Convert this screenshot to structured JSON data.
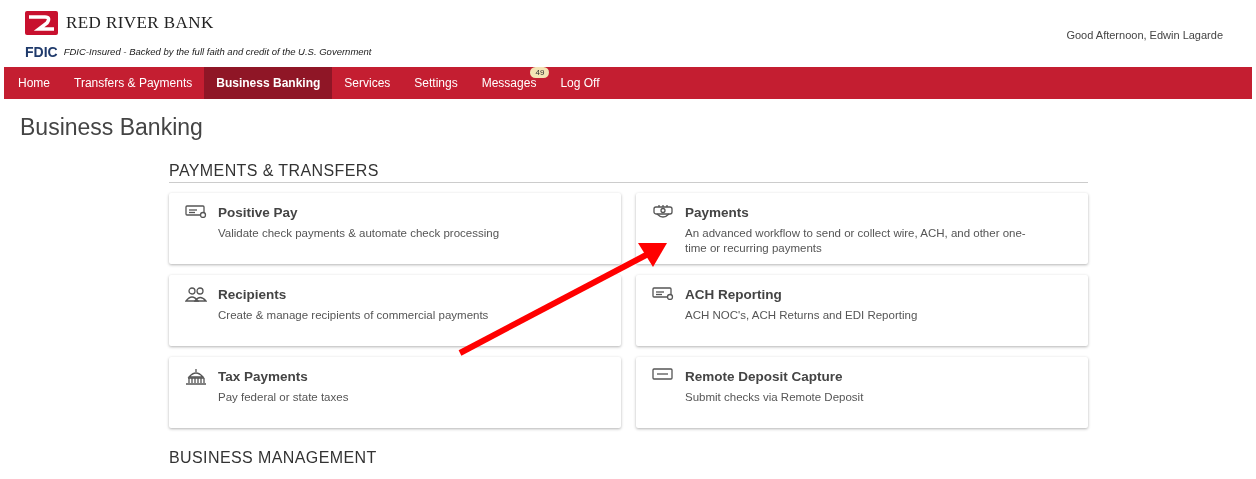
{
  "header": {
    "bank_name": "RED RIVER BANK",
    "fdic_logo": "FDIC",
    "fdic_text": "FDIC-Insured - Backed by the full faith and credit of the U.S. Government",
    "greeting": "Good Afternoon, Edwin Lagarde"
  },
  "nav": [
    {
      "label": "Home",
      "selected": false
    },
    {
      "label": "Transfers & Payments",
      "selected": false
    },
    {
      "label": "Business Banking",
      "selected": true
    },
    {
      "label": "Services",
      "selected": false
    },
    {
      "label": "Settings",
      "selected": false
    },
    {
      "label": "Messages",
      "selected": false,
      "badge": "49"
    },
    {
      "label": "Log Off",
      "selected": false
    }
  ],
  "page_title": "Business Banking",
  "sections": [
    {
      "title": "PAYMENTS & TRANSFERS",
      "cards": [
        {
          "title": "Positive Pay",
          "description": "Validate check payments & automate check processing"
        },
        {
          "title": "Payments",
          "description": "An advanced workflow to send or collect wire, ACH, and other one-time or recurring payments"
        },
        {
          "title": "Recipients",
          "description": "Create & manage recipients of commercial payments"
        },
        {
          "title": "ACH Reporting",
          "description": "ACH NOC's, ACH Returns and EDI Reporting"
        },
        {
          "title": "Tax Payments",
          "description": "Pay federal or state taxes"
        },
        {
          "title": "Remote Deposit Capture",
          "description": "Submit checks via Remote Deposit"
        }
      ]
    },
    {
      "title": "BUSINESS MANAGEMENT"
    }
  ]
}
